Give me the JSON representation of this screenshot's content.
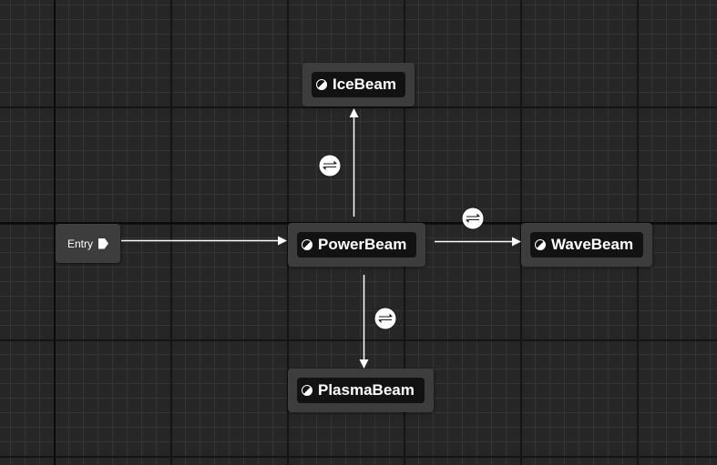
{
  "entry": {
    "label": "Entry"
  },
  "states": {
    "ice_beam": "IceBeam",
    "power_beam": "PowerBeam",
    "wave_beam": "WaveBeam",
    "plasma_beam": "PlasmaBeam"
  },
  "transitions": [
    {
      "from": "PowerBeam",
      "to": "IceBeam"
    },
    {
      "from": "PowerBeam",
      "to": "WaveBeam"
    },
    {
      "from": "PowerBeam",
      "to": "PlasmaBeam"
    }
  ],
  "colors": {
    "canvas": "#262626",
    "node": "#3d3d3d",
    "node_inner": "#121212",
    "wire": "#ffffff"
  },
  "icons": {
    "state": "half-circle-icon",
    "transition": "transition-rule-icon",
    "entry": "entry-arrow-icon"
  }
}
